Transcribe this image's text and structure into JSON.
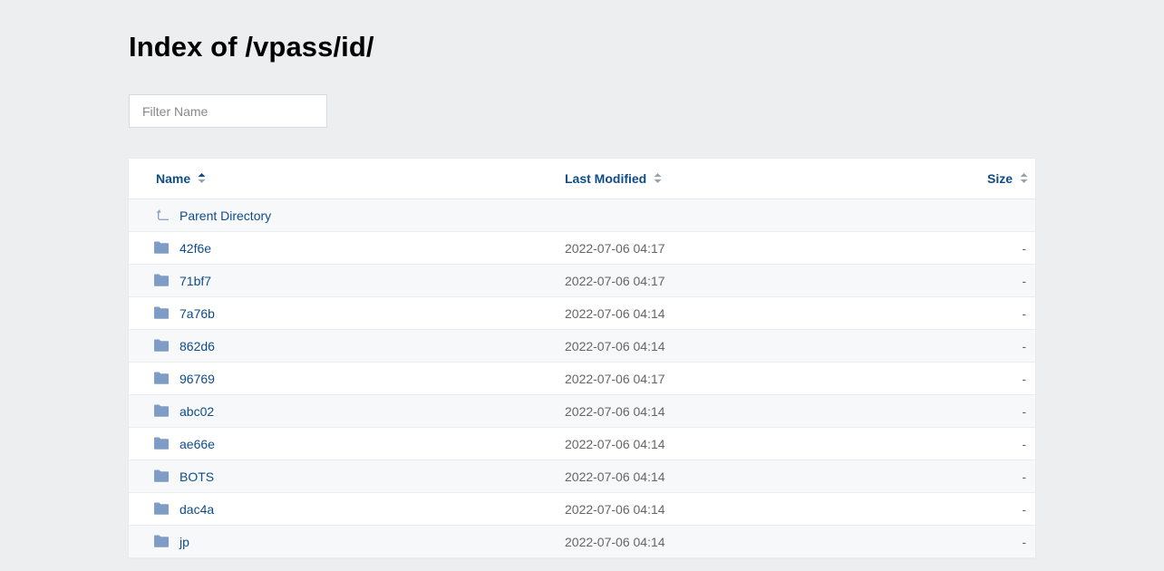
{
  "page": {
    "title": "Index of /vpass/id/"
  },
  "filter": {
    "placeholder": "Filter Name",
    "value": ""
  },
  "columns": {
    "name": "Name",
    "modified": "Last Modified",
    "size": "Size"
  },
  "parent": {
    "label": "Parent Directory",
    "icon": "up-arrow-icon"
  },
  "rows": [
    {
      "name": "42f6e",
      "modified": "2022-07-06 04:17",
      "size": "-"
    },
    {
      "name": "71bf7",
      "modified": "2022-07-06 04:17",
      "size": "-"
    },
    {
      "name": "7a76b",
      "modified": "2022-07-06 04:14",
      "size": "-"
    },
    {
      "name": "862d6",
      "modified": "2022-07-06 04:14",
      "size": "-"
    },
    {
      "name": "96769",
      "modified": "2022-07-06 04:17",
      "size": "-"
    },
    {
      "name": "abc02",
      "modified": "2022-07-06 04:14",
      "size": "-"
    },
    {
      "name": "ae66e",
      "modified": "2022-07-06 04:14",
      "size": "-"
    },
    {
      "name": "BOTS",
      "modified": "2022-07-06 04:14",
      "size": "-"
    },
    {
      "name": "dac4a",
      "modified": "2022-07-06 04:14",
      "size": "-"
    },
    {
      "name": "jp",
      "modified": "2022-07-06 04:14",
      "size": "-"
    }
  ],
  "colors": {
    "link": "#0e4c8a",
    "folder": "#7f9cc4",
    "background": "#eceef0"
  }
}
